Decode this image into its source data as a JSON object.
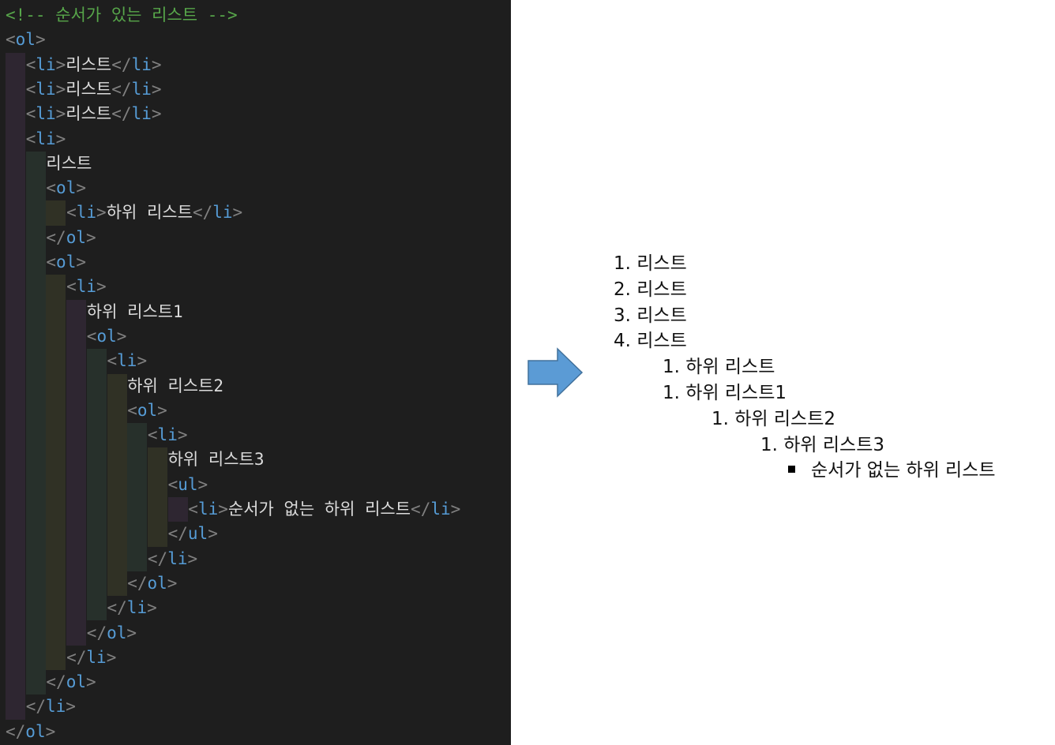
{
  "editor": {
    "lines": [
      {
        "indent": 0,
        "parts": [
          {
            "t": "<!-- 순서가 있는 리스트 -->",
            "c": "comment"
          }
        ]
      },
      {
        "indent": 0,
        "parts": [
          {
            "t": "<",
            "c": "punct"
          },
          {
            "t": "ol",
            "c": "tag"
          },
          {
            "t": ">",
            "c": "punct"
          }
        ]
      },
      {
        "indent": 1,
        "parts": [
          {
            "t": "<",
            "c": "punct"
          },
          {
            "t": "li",
            "c": "tag"
          },
          {
            "t": ">",
            "c": "punct"
          },
          {
            "t": "리스트",
            "c": "txt"
          },
          {
            "t": "</",
            "c": "punct"
          },
          {
            "t": "li",
            "c": "tag"
          },
          {
            "t": ">",
            "c": "punct"
          }
        ]
      },
      {
        "indent": 1,
        "parts": [
          {
            "t": "<",
            "c": "punct"
          },
          {
            "t": "li",
            "c": "tag"
          },
          {
            "t": ">",
            "c": "punct"
          },
          {
            "t": "리스트",
            "c": "txt"
          },
          {
            "t": "</",
            "c": "punct"
          },
          {
            "t": "li",
            "c": "tag"
          },
          {
            "t": ">",
            "c": "punct"
          }
        ]
      },
      {
        "indent": 1,
        "parts": [
          {
            "t": "<",
            "c": "punct"
          },
          {
            "t": "li",
            "c": "tag"
          },
          {
            "t": ">",
            "c": "punct"
          },
          {
            "t": "리스트",
            "c": "txt"
          },
          {
            "t": "</",
            "c": "punct"
          },
          {
            "t": "li",
            "c": "tag"
          },
          {
            "t": ">",
            "c": "punct"
          }
        ]
      },
      {
        "indent": 1,
        "parts": [
          {
            "t": "<",
            "c": "punct"
          },
          {
            "t": "li",
            "c": "tag"
          },
          {
            "t": ">",
            "c": "punct"
          }
        ]
      },
      {
        "indent": 2,
        "parts": [
          {
            "t": "리스트",
            "c": "txt"
          }
        ]
      },
      {
        "indent": 2,
        "parts": [
          {
            "t": "<",
            "c": "punct"
          },
          {
            "t": "ol",
            "c": "tag"
          },
          {
            "t": ">",
            "c": "punct"
          }
        ]
      },
      {
        "indent": 3,
        "parts": [
          {
            "t": "<",
            "c": "punct"
          },
          {
            "t": "li",
            "c": "tag"
          },
          {
            "t": ">",
            "c": "punct"
          },
          {
            "t": "하위 리스트",
            "c": "txt"
          },
          {
            "t": "</",
            "c": "punct"
          },
          {
            "t": "li",
            "c": "tag"
          },
          {
            "t": ">",
            "c": "punct"
          }
        ]
      },
      {
        "indent": 2,
        "parts": [
          {
            "t": "</",
            "c": "punct"
          },
          {
            "t": "ol",
            "c": "tag"
          },
          {
            "t": ">",
            "c": "punct"
          }
        ]
      },
      {
        "indent": 2,
        "parts": [
          {
            "t": "<",
            "c": "punct"
          },
          {
            "t": "ol",
            "c": "tag"
          },
          {
            "t": ">",
            "c": "punct"
          }
        ]
      },
      {
        "indent": 3,
        "parts": [
          {
            "t": "<",
            "c": "punct"
          },
          {
            "t": "li",
            "c": "tag"
          },
          {
            "t": ">",
            "c": "punct"
          }
        ]
      },
      {
        "indent": 4,
        "parts": [
          {
            "t": "하위 리스트1",
            "c": "txt"
          }
        ]
      },
      {
        "indent": 4,
        "parts": [
          {
            "t": "<",
            "c": "punct"
          },
          {
            "t": "ol",
            "c": "tag"
          },
          {
            "t": ">",
            "c": "punct"
          }
        ]
      },
      {
        "indent": 5,
        "parts": [
          {
            "t": "<",
            "c": "punct"
          },
          {
            "t": "li",
            "c": "tag"
          },
          {
            "t": ">",
            "c": "punct"
          }
        ]
      },
      {
        "indent": 6,
        "parts": [
          {
            "t": "하위 리스트2",
            "c": "txt"
          }
        ]
      },
      {
        "indent": 6,
        "parts": [
          {
            "t": "<",
            "c": "punct"
          },
          {
            "t": "ol",
            "c": "tag"
          },
          {
            "t": ">",
            "c": "punct"
          }
        ]
      },
      {
        "indent": 7,
        "parts": [
          {
            "t": "<",
            "c": "punct"
          },
          {
            "t": "li",
            "c": "tag"
          },
          {
            "t": ">",
            "c": "punct"
          }
        ]
      },
      {
        "indent": 8,
        "parts": [
          {
            "t": "하위 리스트3",
            "c": "txt"
          }
        ]
      },
      {
        "indent": 8,
        "parts": [
          {
            "t": "<",
            "c": "punct"
          },
          {
            "t": "ul",
            "c": "tag"
          },
          {
            "t": ">",
            "c": "punct"
          }
        ]
      },
      {
        "indent": 9,
        "parts": [
          {
            "t": "<",
            "c": "punct"
          },
          {
            "t": "li",
            "c": "tag"
          },
          {
            "t": ">",
            "c": "punct"
          },
          {
            "t": "순서가 없는 하위 리스트",
            "c": "txt"
          },
          {
            "t": "</",
            "c": "punct"
          },
          {
            "t": "li",
            "c": "tag"
          },
          {
            "t": ">",
            "c": "punct"
          }
        ]
      },
      {
        "indent": 8,
        "parts": [
          {
            "t": "</",
            "c": "punct"
          },
          {
            "t": "ul",
            "c": "tag"
          },
          {
            "t": ">",
            "c": "punct"
          }
        ]
      },
      {
        "indent": 7,
        "parts": [
          {
            "t": "</",
            "c": "punct"
          },
          {
            "t": "li",
            "c": "tag"
          },
          {
            "t": ">",
            "c": "punct"
          }
        ]
      },
      {
        "indent": 6,
        "parts": [
          {
            "t": "</",
            "c": "punct"
          },
          {
            "t": "ol",
            "c": "tag"
          },
          {
            "t": ">",
            "c": "punct"
          }
        ]
      },
      {
        "indent": 5,
        "parts": [
          {
            "t": "</",
            "c": "punct"
          },
          {
            "t": "li",
            "c": "tag"
          },
          {
            "t": ">",
            "c": "punct"
          }
        ]
      },
      {
        "indent": 4,
        "parts": [
          {
            "t": "</",
            "c": "punct"
          },
          {
            "t": "ol",
            "c": "tag"
          },
          {
            "t": ">",
            "c": "punct"
          }
        ]
      },
      {
        "indent": 3,
        "parts": [
          {
            "t": "</",
            "c": "punct"
          },
          {
            "t": "li",
            "c": "tag"
          },
          {
            "t": ">",
            "c": "punct"
          }
        ]
      },
      {
        "indent": 2,
        "parts": [
          {
            "t": "</",
            "c": "punct"
          },
          {
            "t": "ol",
            "c": "tag"
          },
          {
            "t": ">",
            "c": "punct"
          }
        ]
      },
      {
        "indent": 1,
        "parts": [
          {
            "t": "</",
            "c": "punct"
          },
          {
            "t": "li",
            "c": "tag"
          },
          {
            "t": ">",
            "c": "punct"
          }
        ]
      },
      {
        "indent": 0,
        "parts": [
          {
            "t": "</",
            "c": "punct"
          },
          {
            "t": "ol",
            "c": "tag"
          },
          {
            "t": ">",
            "c": "punct"
          }
        ]
      }
    ]
  },
  "arrow": {
    "icon": "right-arrow-icon",
    "fill": "#5b9bd5",
    "stroke": "#41719c"
  },
  "output": {
    "items": [
      {
        "level": 0,
        "marker": "1.",
        "text": "리스트"
      },
      {
        "level": 0,
        "marker": "2.",
        "text": "리스트"
      },
      {
        "level": 0,
        "marker": "3.",
        "text": "리스트"
      },
      {
        "level": 0,
        "marker": "4.",
        "text": "리스트"
      },
      {
        "level": 1,
        "marker": "1.",
        "text": "하위 리스트"
      },
      {
        "level": 1,
        "marker": "1.",
        "text": "하위 리스트1"
      },
      {
        "level": 2,
        "marker": "1.",
        "text": "하위 리스트2"
      },
      {
        "level": 3,
        "marker": "1.",
        "text": "하위 리스트3"
      },
      {
        "level": 4,
        "marker": "bullet-square",
        "text": "순서가 없는 하위 리스트"
      }
    ]
  }
}
